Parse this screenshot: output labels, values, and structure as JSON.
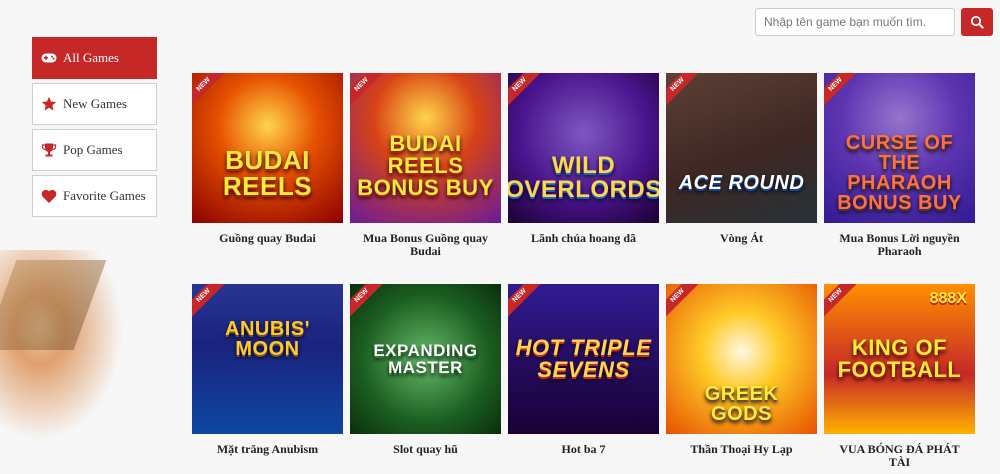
{
  "search": {
    "placeholder": "Nhập tên game bạn muốn tìm.",
    "value": ""
  },
  "sidebar": {
    "items": [
      {
        "label": "All Games",
        "icon": "gamepad-icon",
        "active": true
      },
      {
        "label": "New Games",
        "icon": "star-icon",
        "active": false
      },
      {
        "label": "Pop Games",
        "icon": "trophy-icon",
        "active": false
      },
      {
        "label": "Favorite Games",
        "icon": "heart-icon",
        "active": false
      }
    ]
  },
  "games": [
    {
      "title": "Guồng quay Budai",
      "badge": "NEW",
      "art": "BUDAI REELS"
    },
    {
      "title": "Mua Bonus Guồng quay Budai",
      "badge": "NEW",
      "art": "BUDAI REELS BONUS BUY"
    },
    {
      "title": "Lãnh chúa hoang dã",
      "badge": "NEW",
      "art": "WILD OVERLORDS"
    },
    {
      "title": "Vòng Át",
      "badge": "NEW",
      "art": "ACE ROUND"
    },
    {
      "title": "Mua Bonus Lời nguyền Pharaoh",
      "badge": "NEW",
      "art": "CURSE OF THE PHARAOH BONUS BUY"
    },
    {
      "title": "Mặt trăng Anubism",
      "badge": "NEW",
      "art": "ANUBIS' MOON"
    },
    {
      "title": "Slot quay hũ",
      "badge": "NEW",
      "art": "EXPANDING MASTER"
    },
    {
      "title": "Hot ba 7",
      "badge": "NEW",
      "art": "HOT TRIPLE SEVENS"
    },
    {
      "title": "Thần Thoại Hy Lạp",
      "badge": "NEW",
      "art": "GREEK GODS"
    },
    {
      "title": "VUA BÓNG ĐÁ PHÁT TÀI",
      "badge": "NEW",
      "art": "KING OF FOOTBALL",
      "multiplier": "888X"
    }
  ],
  "colors": {
    "accent": "#c62828",
    "background": "#f7f7f7"
  }
}
